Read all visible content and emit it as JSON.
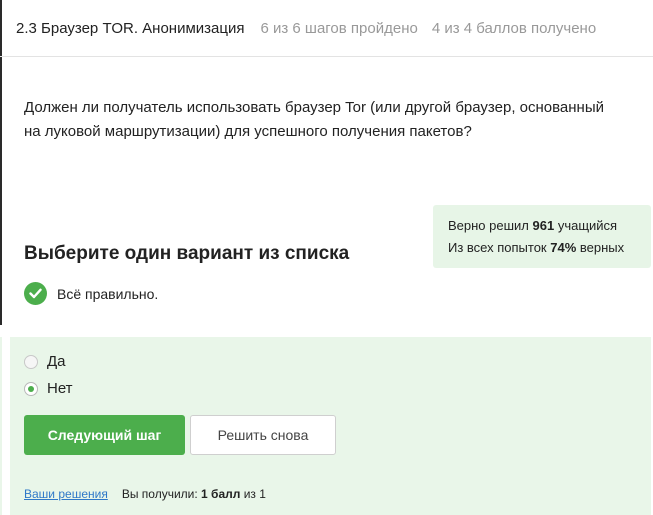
{
  "header": {
    "lesson_title": "2.3 Браузер TOR. Анонимизация",
    "steps_progress": "6 из 6 шагов пройдено",
    "points_progress": "4 из 4 баллов  получено"
  },
  "question": {
    "text": "Должен ли получатель использовать браузер Tor (или другой браузер, основанный на луковой маршрутизации) для успешного получения пакетов?"
  },
  "stats": {
    "solved_prefix": "Верно решил ",
    "solved_count": "961",
    "solved_suffix": " учащийся",
    "attempts_prefix": "Из всех попыток ",
    "attempts_percent": "74%",
    "attempts_suffix": " верных"
  },
  "choose_title": "Выберите один вариант из списка",
  "result": {
    "text": "Всё правильно.",
    "icon": "check-circle-icon",
    "color": "#4cae4c"
  },
  "options": [
    {
      "label": "Да",
      "checked": false
    },
    {
      "label": "Нет",
      "checked": true
    }
  ],
  "buttons": {
    "next_label": "Следующий шаг",
    "retry_label": "Решить снова"
  },
  "footer": {
    "solutions_link": "Ваши решения",
    "score_prefix": "Вы получили: ",
    "score_value": "1 балл",
    "score_suffix": " из 1"
  },
  "colors": {
    "accent": "#4cae4c",
    "panel": "#e9f6e9",
    "link": "#2f78c8"
  }
}
